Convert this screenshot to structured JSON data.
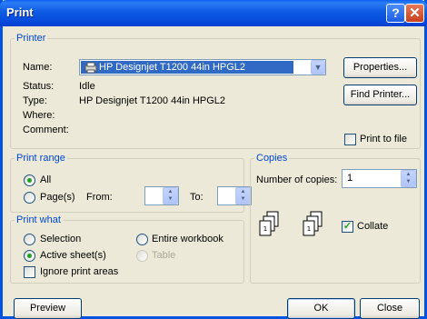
{
  "window": {
    "title": "Print",
    "help_label": "?",
    "close_label": "✕"
  },
  "printer": {
    "legend": "Printer",
    "name_label": "Name:",
    "name_value": "HP Designjet T1200 44in HPGL2",
    "status_label": "Status:",
    "status_value": "Idle",
    "type_label": "Type:",
    "type_value": "HP Designjet T1200 44in HPGL2",
    "where_label": "Where:",
    "comment_label": "Comment:",
    "properties_button": "Properties...",
    "find_printer_button": "Find Printer...",
    "print_to_file_label": "Print to file",
    "print_to_file_checked": false
  },
  "print_range": {
    "legend": "Print range",
    "all_label": "All",
    "pages_label": "Page(s)",
    "from_label": "From:",
    "to_label": "To:",
    "from_value": "",
    "to_value": "",
    "selected": "all"
  },
  "copies": {
    "legend": "Copies",
    "number_label": "Number of copies:",
    "number_value": "1",
    "collate_label": "Collate",
    "collate_checked": true
  },
  "print_what": {
    "legend": "Print what",
    "selection_label": "Selection",
    "entire_workbook_label": "Entire workbook",
    "active_sheets_label": "Active sheet(s)",
    "table_label": "Table",
    "ignore_print_areas_label": "Ignore print areas",
    "selected": "active_sheets"
  },
  "footer": {
    "preview_button": "Preview",
    "ok_button": "OK",
    "close_button": "Close"
  }
}
